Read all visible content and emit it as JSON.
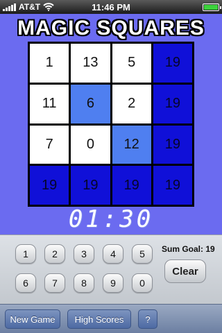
{
  "status_bar": {
    "carrier": "AT&T",
    "time": "11:46 PM",
    "signal_icon": "signal-bars-icon",
    "wifi_icon": "wifi-icon",
    "battery_icon": "battery-icon",
    "battery_level": 1.0
  },
  "title": "MAGIC SQUARES",
  "grid": {
    "cells": [
      {
        "value": "1",
        "style": "white"
      },
      {
        "value": "13",
        "style": "white"
      },
      {
        "value": "5",
        "style": "white"
      },
      {
        "value": "19",
        "style": "dark"
      },
      {
        "value": "11",
        "style": "white"
      },
      {
        "value": "6",
        "style": "light"
      },
      {
        "value": "2",
        "style": "white"
      },
      {
        "value": "19",
        "style": "dark"
      },
      {
        "value": "7",
        "style": "white"
      },
      {
        "value": "0",
        "style": "white"
      },
      {
        "value": "12",
        "style": "light"
      },
      {
        "value": "19",
        "style": "dark"
      },
      {
        "value": "19",
        "style": "dark"
      },
      {
        "value": "19",
        "style": "dark"
      },
      {
        "value": "19",
        "style": "dark"
      },
      {
        "value": "19",
        "style": "dark"
      }
    ]
  },
  "timer": "01:30",
  "keypad": {
    "keys": [
      "1",
      "2",
      "3",
      "4",
      "5",
      "6",
      "7",
      "8",
      "9",
      "0"
    ],
    "sum_goal": "Sum Goal: 19",
    "clear_label": "Clear"
  },
  "toolbar": {
    "new_game_label": "New Game",
    "high_scores_label": "High Scores",
    "help_label": "?"
  },
  "colors": {
    "background": "#6b6bf0",
    "cell_white": "#ffffff",
    "cell_light": "#4f7ff0",
    "cell_dark": "#1010d8"
  }
}
